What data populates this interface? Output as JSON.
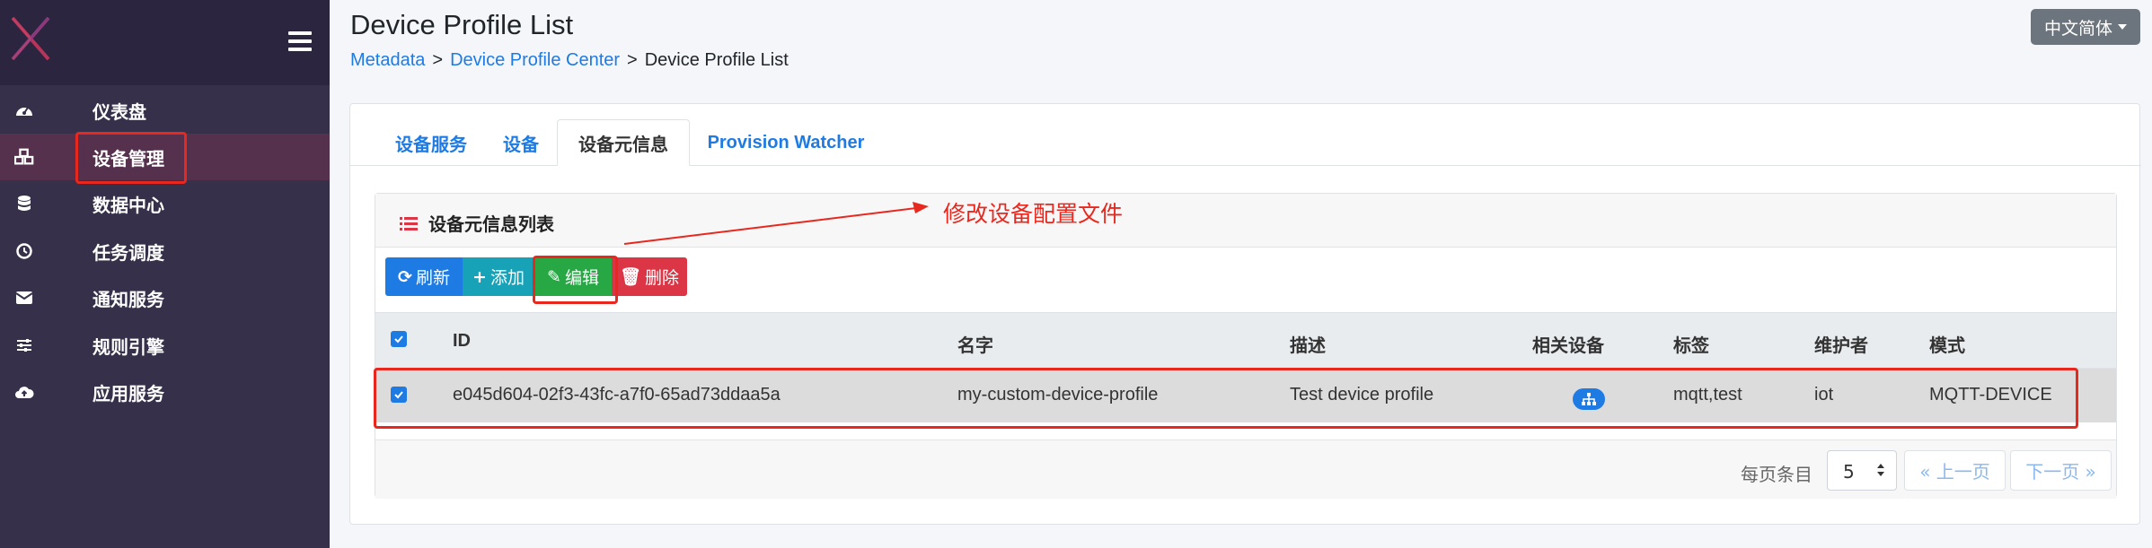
{
  "header": {
    "title": "Device Profile List",
    "breadcrumb": [
      "Metadata",
      "Device Profile Center",
      "Device Profile List"
    ],
    "breadcrumb_sep": ">",
    "language": "中文简体"
  },
  "sidebar": {
    "items": [
      {
        "label": "仪表盘",
        "icon": "dashboard-icon"
      },
      {
        "label": "设备管理",
        "icon": "cubes-icon"
      },
      {
        "label": "数据中心",
        "icon": "database-icon"
      },
      {
        "label": "任务调度",
        "icon": "clock-icon"
      },
      {
        "label": "通知服务",
        "icon": "envelope-icon"
      },
      {
        "label": "规则引擎",
        "icon": "sliders-icon"
      },
      {
        "label": "应用服务",
        "icon": "cloud-upload-icon"
      }
    ]
  },
  "tabs": [
    {
      "label": "设备服务"
    },
    {
      "label": "设备"
    },
    {
      "label": "设备元信息"
    },
    {
      "label": "Provision Watcher"
    }
  ],
  "panel": {
    "title": "设备元信息列表",
    "buttons": {
      "refresh": "刷新",
      "add": "添加",
      "edit": "编辑",
      "delete": "删除"
    },
    "columns": [
      "ID",
      "名字",
      "描述",
      "相关设备",
      "标签",
      "维护者",
      "模式"
    ],
    "rows": [
      {
        "id": "e045d604-02f3-43fc-a7f0-65ad73ddaa5a",
        "name": "my-custom-device-profile",
        "description": "Test device profile",
        "labels": "mqtt,test",
        "maintainer": "iot",
        "model": "MQTT-DEVICE"
      }
    ],
    "pagination": {
      "per_page_label": "每页条目",
      "per_page": "5",
      "prev": "« 上一页",
      "next": "下一页 »"
    }
  },
  "annotation": {
    "text": "修改设备配置文件"
  },
  "colors": {
    "primary": "#1e7be4",
    "info": "#17a2b8",
    "success": "#28a745",
    "danger": "#dc3545",
    "sidebar": "#37304a",
    "annotation": "#e8281f"
  }
}
